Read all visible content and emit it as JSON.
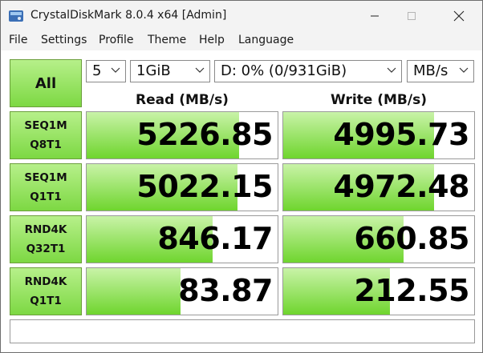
{
  "window": {
    "title": "CrystalDiskMark 8.0.4 x64 [Admin]"
  },
  "menu": [
    "File",
    "Settings",
    "Profile",
    "Theme",
    "Help",
    "Language"
  ],
  "controls": {
    "all_label": "All",
    "count": "5",
    "size": "1GiB",
    "drive": "D: 0% (0/931GiB)",
    "unit": "MB/s"
  },
  "headers": {
    "read": "Read (MB/s)",
    "write": "Write (MB/s)"
  },
  "tests": [
    {
      "line1": "SEQ1M",
      "line2": "Q8T1",
      "read": "5226.85",
      "write": "4995.73",
      "read_fill": 0.8,
      "write_fill": 0.79
    },
    {
      "line1": "SEQ1M",
      "line2": "Q1T1",
      "read": "5022.15",
      "write": "4972.48",
      "read_fill": 0.79,
      "write_fill": 0.79
    },
    {
      "line1": "RND4K",
      "line2": "Q32T1",
      "read": "846.17",
      "write": "660.85",
      "read_fill": 0.66,
      "write_fill": 0.63
    },
    {
      "line1": "RND4K",
      "line2": "Q1T1",
      "read": "83.87",
      "write": "212.55",
      "read_fill": 0.49,
      "write_fill": 0.56
    }
  ],
  "comment": "",
  "colors": {
    "accent_light": "#c9f3a8",
    "accent_dark": "#6fd52e"
  }
}
